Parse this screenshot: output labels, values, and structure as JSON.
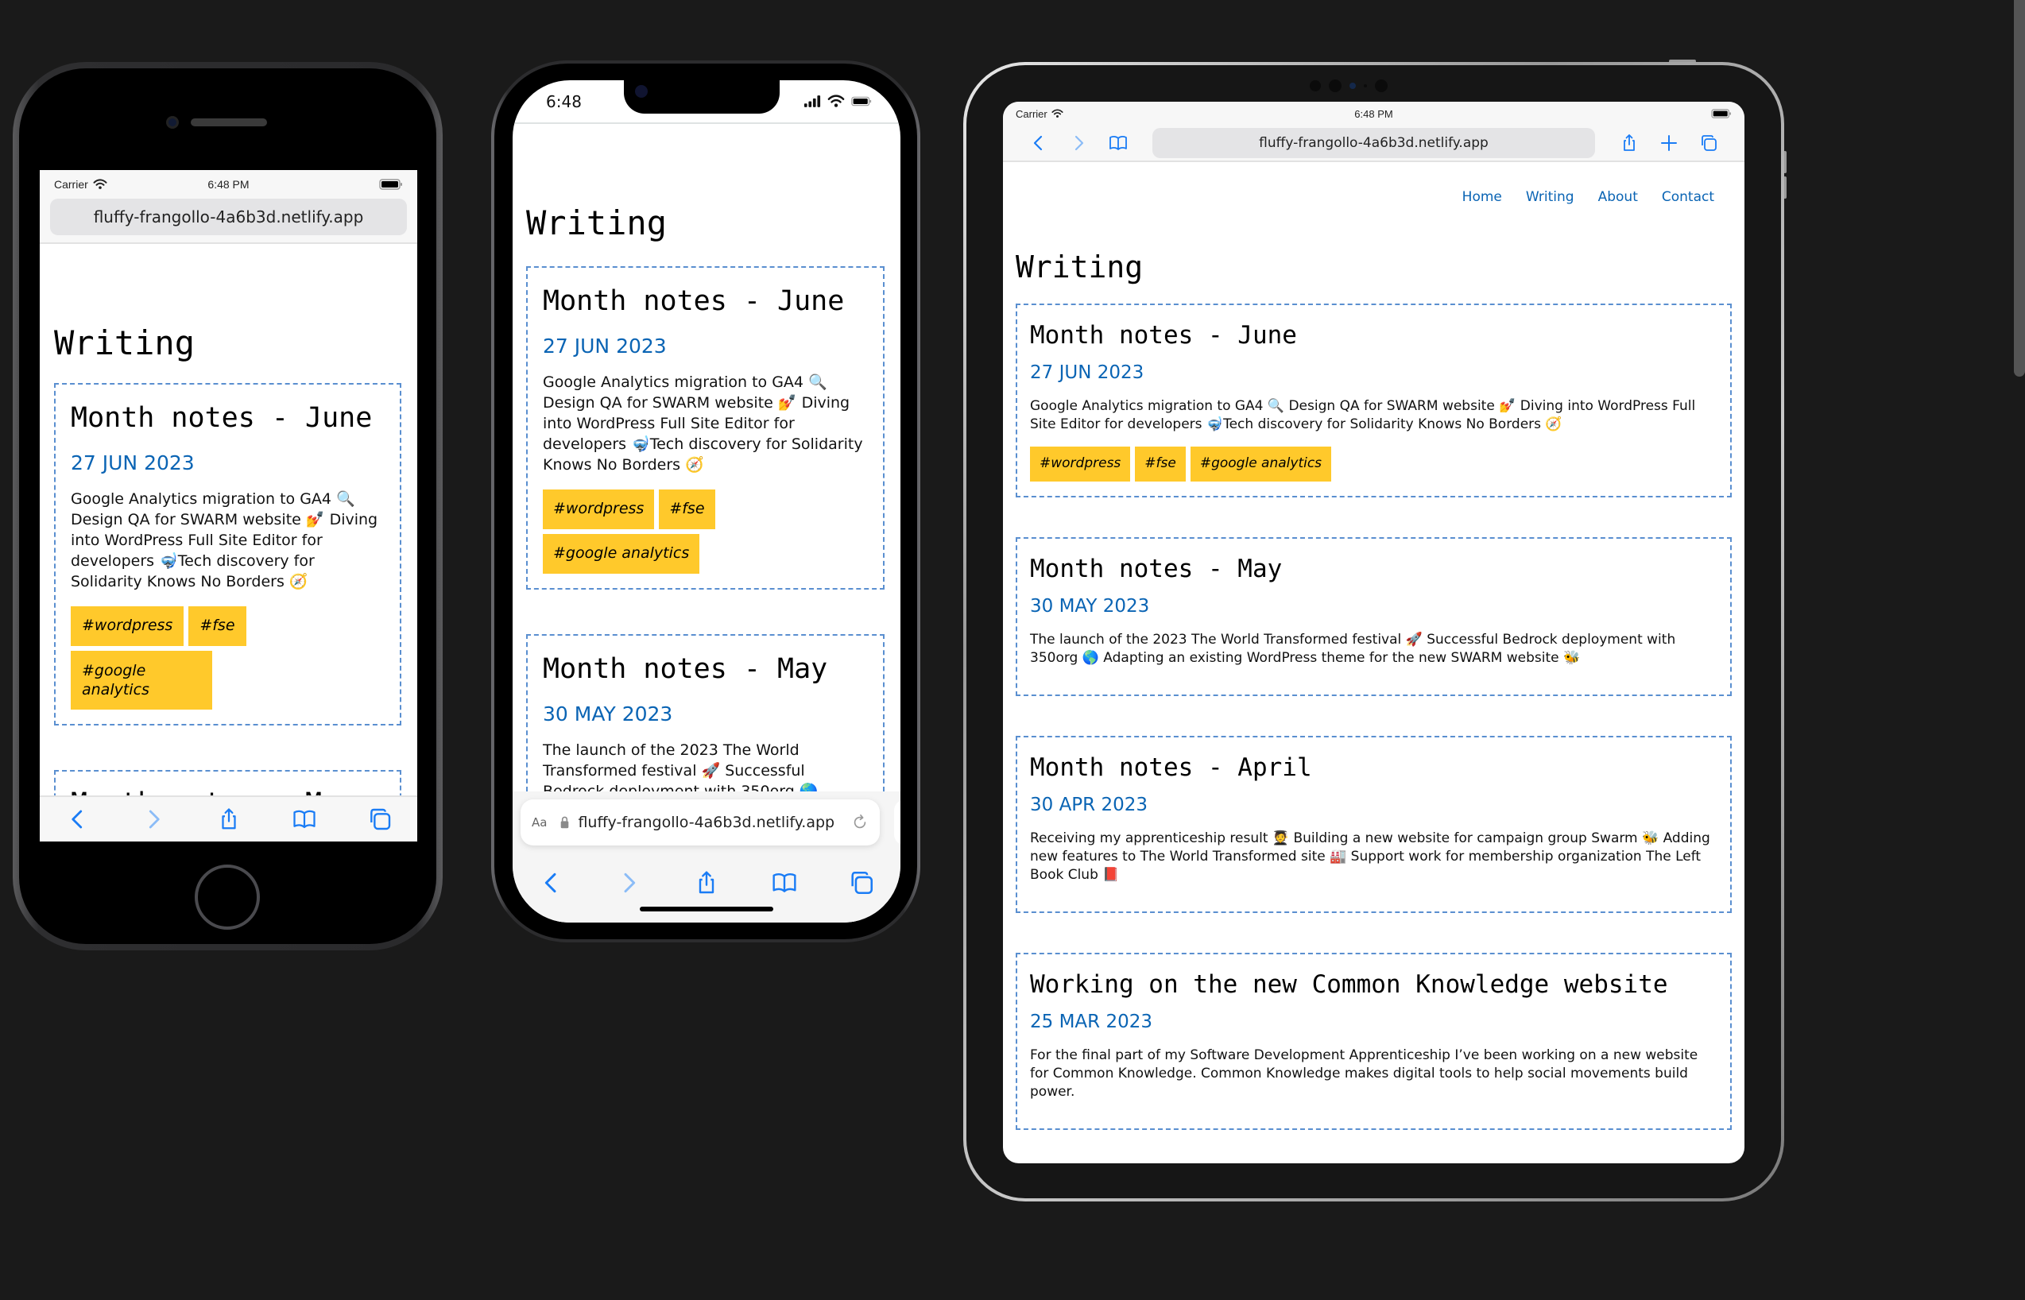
{
  "url": "fluffy-frangollo-4a6b3d.netlify.app",
  "status_bar": {
    "carrier": "Carrier",
    "time_full": "6:48 PM",
    "time_short": "6:48"
  },
  "reader_label": "Aa",
  "site_nav": [
    {
      "label": "Home"
    },
    {
      "label": "Writing"
    },
    {
      "label": "About"
    },
    {
      "label": "Contact"
    }
  ],
  "page_title": "Writing",
  "posts": [
    {
      "title": "Month notes - June",
      "date": "27 JUN 2023",
      "excerpt": "Google Analytics migration to GA4 🔍 Design QA for SWARM website 💅 Diving into WordPress Full Site Editor for developers 🤿Tech discovery for Solidarity Knows No Borders 🧭",
      "tags": [
        "#wordpress",
        "#fse",
        "#google analytics"
      ]
    },
    {
      "title": "Month notes - May",
      "date": "30 MAY 2023",
      "excerpt": "The launch of the 2023 The World Transformed festival 🚀 Successful Bedrock deployment with 350org 🌎 Adapting an existing WordPress theme for the new SWARM website 🐝",
      "tags": []
    },
    {
      "title": "Month notes - April",
      "date": "30 APR 2023",
      "excerpt": "Receiving my apprenticeship result 🧑‍🎓 Building a new website for campaign group Swarm 🐝 Adding new features to The World Transformed site 🏭 Support work for membership organization The Left Book Club 📕",
      "tags": []
    },
    {
      "title": "Working on the new Common Knowledge website",
      "date": "25 MAR 2023",
      "excerpt": "For the final part of my Software Development Apprenticeship I’ve been working on a new website for Common Knowledge. Common Knowledge makes digital tools to help social movements build power.",
      "tags": []
    }
  ],
  "colors": {
    "accent": "#0a64b4",
    "tag_bg": "#ffc92b",
    "card_border": "#5a8fd0",
    "ios_blue": "#1a7cf5",
    "backdrop": "#1a1a1a"
  }
}
